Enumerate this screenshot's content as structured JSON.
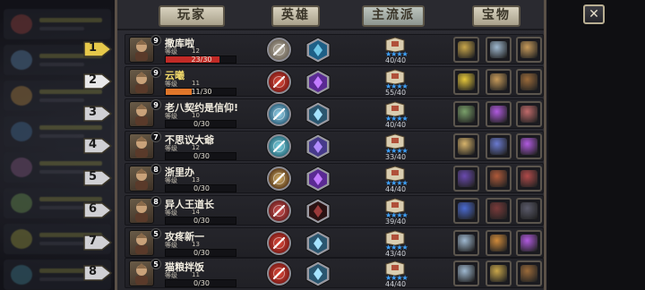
{
  "tabs": [
    {
      "label": "玩家",
      "active": false
    },
    {
      "label": "英雄",
      "active": false
    },
    {
      "label": "主流派",
      "active": true
    },
    {
      "label": "宝物",
      "active": false
    }
  ],
  "close_label": "✕",
  "level_label": "等级",
  "rows": [
    {
      "rank": "1",
      "rank_color": "#e6c84a",
      "name": "撒库啦",
      "name_color": "#f2ede0",
      "hero_level": "12",
      "portrait_badge": "9",
      "xp_text": "23/30",
      "xp_fraction": 0.77,
      "xp_color": "#c22a26",
      "progress": "40/40",
      "stars": "★★★★",
      "skills": [
        "target-icon",
        "water-blade-icon"
      ],
      "items": [
        "medal-icon",
        "bracelet-icon",
        "scales-icon"
      ]
    },
    {
      "rank": "2",
      "rank_color": "#e8e8ea",
      "name": "云曦",
      "name_color": "#f0d86a",
      "hero_level": "11",
      "portrait_badge": "9",
      "xp_text": "11/30",
      "xp_fraction": 0.37,
      "xp_color": "#e0762a",
      "progress": "55/40",
      "stars": "★★★★",
      "skills": [
        "red-slash-icon",
        "purple-crystal-icon"
      ],
      "items": [
        "clover-icon",
        "scales-icon",
        "horn-icon"
      ]
    },
    {
      "rank": "3",
      "rank_color": "#d0d0d4",
      "name": "老八契约是信仰!",
      "name_color": "#f2ede0",
      "hero_level": "10",
      "portrait_badge": "9",
      "xp_text": "0/30",
      "xp_fraction": 0,
      "xp_color": "#c22a26",
      "progress": "40/40",
      "stars": "★★★★",
      "skills": [
        "ice-snowflake-icon",
        "ice-hex-icon"
      ],
      "items": [
        "scroll-icon",
        "potion-icon",
        "ring-icon"
      ]
    },
    {
      "rank": "4",
      "rank_color": "#d0d0d4",
      "name": "不思议大爺",
      "name_color": "#f2ede0",
      "hero_level": "12",
      "portrait_badge": "7",
      "xp_text": "0/30",
      "xp_fraction": 0,
      "xp_color": "#c22a26",
      "progress": "33/40",
      "stars": "★★★★",
      "skills": [
        "whirlwind-icon",
        "purple-star-icon"
      ],
      "items": [
        "compass-icon",
        "book-icon",
        "potion-icon"
      ]
    },
    {
      "rank": "5",
      "rank_color": "#d0d0d4",
      "name": "浙里办",
      "name_color": "#f2ede0",
      "hero_level": "13",
      "portrait_badge": "8",
      "xp_text": "0/30",
      "xp_fraction": 0,
      "xp_color": "#c22a26",
      "progress": "44/40",
      "stars": "★★★★",
      "skills": [
        "arrow-icon",
        "purple-crystal-icon"
      ],
      "items": [
        "rune-book-icon",
        "chest-icon",
        "mask-icon"
      ]
    },
    {
      "rank": "6",
      "rank_color": "#d0d0d4",
      "name": "异人王道长",
      "name_color": "#f2ede0",
      "hero_level": "14",
      "portrait_badge": "8",
      "xp_text": "0/30",
      "xp_fraction": 0,
      "xp_color": "#c22a26",
      "progress": "39/40",
      "stars": "★★★★",
      "skills": [
        "shield-icon",
        "dark-ring-icon"
      ],
      "items": [
        "crystal-icon",
        "cloak-icon",
        "tome-icon"
      ]
    },
    {
      "rank": "7",
      "rank_color": "#d0d0d4",
      "name": "攻疼新一",
      "name_color": "#f2ede0",
      "hero_level": "13",
      "portrait_badge": "5",
      "xp_text": "0/30",
      "xp_fraction": 0,
      "xp_color": "#c22a26",
      "progress": "43/40",
      "stars": "★★★★",
      "skills": [
        "red-slash-icon",
        "ice-hex-icon"
      ],
      "items": [
        "bracelet-icon",
        "goblet-icon",
        "potion-icon"
      ]
    },
    {
      "rank": "8",
      "rank_color": "#d0d0d4",
      "name": "猫粮拌饭",
      "name_color": "#f2ede0",
      "hero_level": "11",
      "portrait_badge": "5",
      "xp_text": "0/30",
      "xp_fraction": 0,
      "xp_color": "#c22a26",
      "progress": "44/40",
      "stars": "★★★★",
      "skills": [
        "red-slash-icon",
        "ice-hex-icon"
      ],
      "items": [
        "bracelet-icon",
        "medal-icon",
        "horn-icon"
      ]
    }
  ]
}
